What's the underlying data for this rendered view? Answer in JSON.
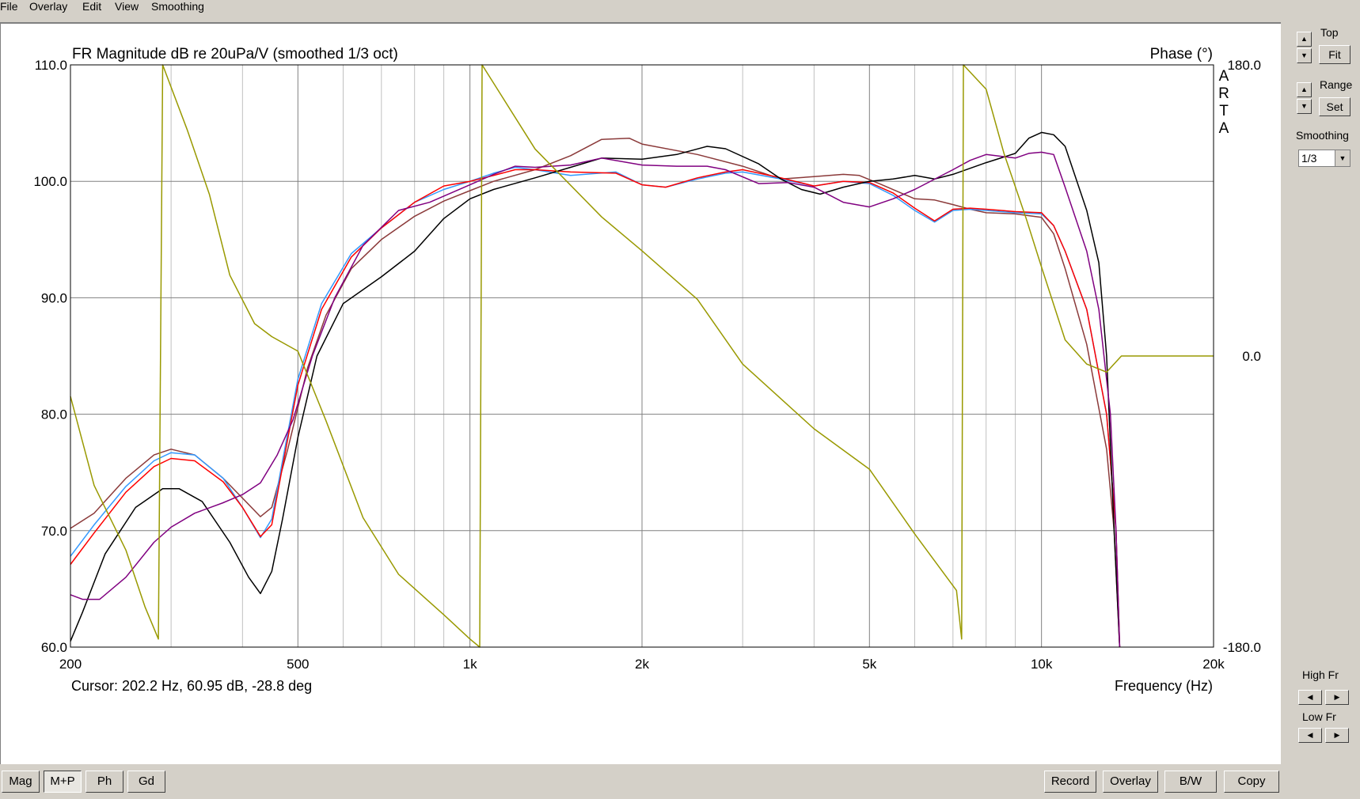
{
  "menu": {
    "items": [
      "File",
      "Overlay",
      "Edit",
      "View",
      "Smoothing"
    ]
  },
  "side": {
    "top_label": "Top",
    "fit_label": "Fit",
    "range_label": "Range",
    "set_label": "Set",
    "smoothing_label": "Smoothing",
    "smoothing_value": "1/3",
    "high_fr_label": "High Fr",
    "low_fr_label": "Low Fr",
    "arrow_up": "▲",
    "arrow_down": "▼",
    "arrow_left": "◀",
    "arrow_right": "▶"
  },
  "bottom": {
    "left_buttons": [
      "Mag",
      "M+P",
      "Ph",
      "Gd"
    ],
    "active_button": "M+P",
    "right_buttons": [
      "Record",
      "Overlay",
      "B/W",
      "Copy"
    ]
  },
  "chart_data": {
    "type": "line",
    "title": "FR Magnitude dB re 20uPa/V (smoothed 1/3 oct)",
    "right_title": "Phase (°)",
    "xlabel": "Frequency (Hz)",
    "vertical_tag": "ARTA",
    "cursor_text": "Cursor: 202.2 Hz, 60.95 dB, -28.8 deg",
    "x_scale": "log",
    "xlim": [
      200,
      20000
    ],
    "ylim": [
      60,
      110
    ],
    "y2lim": [
      -180,
      180
    ],
    "x_ticks": [
      {
        "v": 200,
        "label": "200"
      },
      {
        "v": 500,
        "label": "500"
      },
      {
        "v": 1000,
        "label": "1k"
      },
      {
        "v": 2000,
        "label": "2k"
      },
      {
        "v": 5000,
        "label": "5k"
      },
      {
        "v": 10000,
        "label": "10k"
      },
      {
        "v": 20000,
        "label": "20k"
      }
    ],
    "y_ticks": [
      "60.0",
      "70.0",
      "80.0",
      "90.0",
      "100.0",
      "110.0"
    ],
    "y2_ticks": [
      {
        "v": -180,
        "label": "-180.0"
      },
      {
        "v": 0,
        "label": "0.0"
      },
      {
        "v": 180,
        "label": "180.0"
      }
    ],
    "grid": true,
    "series": [
      {
        "color": "#8b3a3a",
        "axis": "left",
        "points": [
          [
            200,
            70.2
          ],
          [
            220,
            71.5
          ],
          [
            250,
            74.5
          ],
          [
            280,
            76.5
          ],
          [
            300,
            77
          ],
          [
            330,
            76.5
          ],
          [
            370,
            74.5
          ],
          [
            400,
            72.8
          ],
          [
            430,
            71.2
          ],
          [
            450,
            72
          ],
          [
            480,
            77
          ],
          [
            520,
            84
          ],
          [
            560,
            88.5
          ],
          [
            620,
            92.5
          ],
          [
            700,
            95
          ],
          [
            800,
            97
          ],
          [
            900,
            98.3
          ],
          [
            1000,
            99.2
          ],
          [
            1100,
            100
          ],
          [
            1300,
            101
          ],
          [
            1500,
            102.2
          ],
          [
            1700,
            103.6
          ],
          [
            1900,
            103.7
          ],
          [
            2000,
            103.2
          ],
          [
            2500,
            102.3
          ],
          [
            3000,
            101.3
          ],
          [
            3500,
            100.2
          ],
          [
            4000,
            100.4
          ],
          [
            4500,
            100.6
          ],
          [
            4800,
            100.5
          ],
          [
            5200,
            99.8
          ],
          [
            6000,
            98.5
          ],
          [
            6500,
            98.4
          ],
          [
            7000,
            98
          ],
          [
            7500,
            97.6
          ],
          [
            8000,
            97.3
          ],
          [
            9000,
            97.2
          ],
          [
            10000,
            96.9
          ],
          [
            10500,
            95.5
          ],
          [
            11000,
            92.5
          ],
          [
            12000,
            86
          ],
          [
            13000,
            77
          ],
          [
            13400,
            70
          ],
          [
            13700,
            60
          ]
        ]
      },
      {
        "color": "#3399ff",
        "axis": "left",
        "points": [
          [
            200,
            67.8
          ],
          [
            220,
            70.5
          ],
          [
            250,
            73.8
          ],
          [
            280,
            76
          ],
          [
            300,
            76.7
          ],
          [
            330,
            76.5
          ],
          [
            370,
            74.5
          ],
          [
            400,
            72
          ],
          [
            430,
            69.4
          ],
          [
            450,
            71
          ],
          [
            470,
            76
          ],
          [
            500,
            83
          ],
          [
            550,
            89.5
          ],
          [
            620,
            93.8
          ],
          [
            700,
            96
          ],
          [
            800,
            98.2
          ],
          [
            900,
            99.3
          ],
          [
            1000,
            100
          ],
          [
            1100,
            100.7
          ],
          [
            1200,
            101.2
          ],
          [
            1300,
            101
          ],
          [
            1500,
            100.5
          ],
          [
            1800,
            100.8
          ],
          [
            2000,
            99.7
          ],
          [
            2200,
            99.5
          ],
          [
            2500,
            100.2
          ],
          [
            2800,
            100.7
          ],
          [
            3000,
            100.8
          ],
          [
            3500,
            100.2
          ],
          [
            4000,
            99.6
          ],
          [
            4500,
            100
          ],
          [
            5000,
            99.8
          ],
          [
            5500,
            98.8
          ],
          [
            6000,
            97.5
          ],
          [
            6500,
            96.5
          ],
          [
            7000,
            97.5
          ],
          [
            7500,
            97.6
          ],
          [
            8000,
            97.5
          ],
          [
            9000,
            97.3
          ],
          [
            10000,
            97.2
          ],
          [
            10500,
            96.2
          ],
          [
            11000,
            94
          ],
          [
            12000,
            89
          ],
          [
            13000,
            80
          ],
          [
            13500,
            70
          ],
          [
            13700,
            60
          ]
        ]
      },
      {
        "color": "#ff0000",
        "axis": "left",
        "points": [
          [
            200,
            67.1
          ],
          [
            220,
            69.8
          ],
          [
            250,
            73.3
          ],
          [
            280,
            75.5
          ],
          [
            300,
            76.2
          ],
          [
            330,
            76
          ],
          [
            370,
            74.2
          ],
          [
            400,
            72
          ],
          [
            430,
            69.5
          ],
          [
            450,
            70.5
          ],
          [
            470,
            75.5
          ],
          [
            500,
            82.5
          ],
          [
            550,
            89
          ],
          [
            620,
            93.5
          ],
          [
            700,
            96
          ],
          [
            800,
            98.2
          ],
          [
            900,
            99.6
          ],
          [
            1000,
            100
          ],
          [
            1100,
            100.5
          ],
          [
            1200,
            101
          ],
          [
            1300,
            101
          ],
          [
            1500,
            100.8
          ],
          [
            1800,
            100.7
          ],
          [
            2000,
            99.7
          ],
          [
            2200,
            99.5
          ],
          [
            2500,
            100.3
          ],
          [
            2800,
            100.8
          ],
          [
            3000,
            101
          ],
          [
            3500,
            100.3
          ],
          [
            4000,
            99.6
          ],
          [
            4500,
            100
          ],
          [
            5000,
            99.9
          ],
          [
            5500,
            99
          ],
          [
            6000,
            97.7
          ],
          [
            6500,
            96.6
          ],
          [
            7000,
            97.6
          ],
          [
            7500,
            97.7
          ],
          [
            8000,
            97.6
          ],
          [
            9000,
            97.4
          ],
          [
            10000,
            97.3
          ],
          [
            10500,
            96.2
          ],
          [
            11000,
            94
          ],
          [
            12000,
            89
          ],
          [
            13000,
            80
          ],
          [
            13500,
            70
          ],
          [
            13700,
            60
          ]
        ]
      },
      {
        "color": "#000000",
        "axis": "left",
        "points": [
          [
            200,
            60.5
          ],
          [
            210,
            63
          ],
          [
            230,
            68
          ],
          [
            260,
            72
          ],
          [
            290,
            73.6
          ],
          [
            310,
            73.6
          ],
          [
            340,
            72.5
          ],
          [
            380,
            69
          ],
          [
            410,
            66
          ],
          [
            430,
            64.6
          ],
          [
            450,
            66.5
          ],
          [
            470,
            71
          ],
          [
            500,
            78
          ],
          [
            540,
            85
          ],
          [
            600,
            89.5
          ],
          [
            700,
            91.8
          ],
          [
            800,
            94
          ],
          [
            900,
            96.8
          ],
          [
            1000,
            98.5
          ],
          [
            1100,
            99.3
          ],
          [
            1300,
            100.3
          ],
          [
            1500,
            101.2
          ],
          [
            1700,
            102
          ],
          [
            2000,
            101.9
          ],
          [
            2300,
            102.3
          ],
          [
            2600,
            103
          ],
          [
            2800,
            102.8
          ],
          [
            3200,
            101.5
          ],
          [
            3500,
            100.2
          ],
          [
            3800,
            99.3
          ],
          [
            4100,
            98.9
          ],
          [
            4500,
            99.5
          ],
          [
            5000,
            100
          ],
          [
            5500,
            100.2
          ],
          [
            6000,
            100.5
          ],
          [
            6500,
            100.2
          ],
          [
            7000,
            100.6
          ],
          [
            8000,
            101.6
          ],
          [
            9000,
            102.4
          ],
          [
            9500,
            103.7
          ],
          [
            10000,
            104.2
          ],
          [
            10500,
            104
          ],
          [
            11000,
            103
          ],
          [
            12000,
            97.5
          ],
          [
            12600,
            93
          ],
          [
            13000,
            85
          ],
          [
            13400,
            70
          ],
          [
            13700,
            60
          ]
        ]
      },
      {
        "color": "#800080",
        "axis": "left",
        "points": [
          [
            200,
            64.5
          ],
          [
            210,
            64.1
          ],
          [
            225,
            64.1
          ],
          [
            250,
            66
          ],
          [
            280,
            69
          ],
          [
            300,
            70.3
          ],
          [
            330,
            71.5
          ],
          [
            370,
            72.4
          ],
          [
            400,
            73.1
          ],
          [
            430,
            74.1
          ],
          [
            460,
            76.5
          ],
          [
            490,
            79.5
          ],
          [
            530,
            85
          ],
          [
            580,
            90
          ],
          [
            650,
            94.5
          ],
          [
            750,
            97.5
          ],
          [
            850,
            98.2
          ],
          [
            1000,
            99.7
          ],
          [
            1100,
            100.6
          ],
          [
            1200,
            101.3
          ],
          [
            1300,
            101.2
          ],
          [
            1500,
            101.4
          ],
          [
            1700,
            102
          ],
          [
            2000,
            101.4
          ],
          [
            2300,
            101.3
          ],
          [
            2600,
            101.3
          ],
          [
            2800,
            101
          ],
          [
            3200,
            99.8
          ],
          [
            3600,
            99.9
          ],
          [
            4000,
            99.5
          ],
          [
            4500,
            98.2
          ],
          [
            5000,
            97.8
          ],
          [
            5500,
            98.5
          ],
          [
            6000,
            99.3
          ],
          [
            7000,
            101
          ],
          [
            7500,
            101.8
          ],
          [
            8000,
            102.3
          ],
          [
            9000,
            102
          ],
          [
            9500,
            102.4
          ],
          [
            10000,
            102.5
          ],
          [
            10500,
            102.3
          ],
          [
            11000,
            99.5
          ],
          [
            12000,
            94
          ],
          [
            12600,
            89
          ],
          [
            13200,
            80
          ],
          [
            13500,
            70
          ],
          [
            13700,
            60
          ]
        ]
      },
      {
        "color": "#999900",
        "axis": "right",
        "points": [
          [
            200,
            -25
          ],
          [
            220,
            -80
          ],
          [
            250,
            -120
          ],
          [
            270,
            -155
          ],
          [
            285,
            -175
          ],
          [
            290,
            180
          ],
          [
            320,
            140
          ],
          [
            350,
            100
          ],
          [
            380,
            50
          ],
          [
            420,
            20
          ],
          [
            450,
            12
          ],
          [
            500,
            3
          ],
          [
            560,
            -40
          ],
          [
            650,
            -100
          ],
          [
            750,
            -135
          ],
          [
            900,
            -160
          ],
          [
            1000,
            -175
          ],
          [
            1040,
            -180
          ],
          [
            1050,
            180
          ],
          [
            1300,
            128
          ],
          [
            1700,
            86
          ],
          [
            2000,
            65
          ],
          [
            2500,
            35
          ],
          [
            3000,
            -5
          ],
          [
            4000,
            -45
          ],
          [
            5000,
            -70
          ],
          [
            6000,
            -110
          ],
          [
            7100,
            -145
          ],
          [
            7250,
            -175
          ],
          [
            7300,
            180
          ],
          [
            8000,
            165
          ],
          [
            8600,
            125
          ],
          [
            9400,
            85
          ],
          [
            10000,
            55
          ],
          [
            11000,
            10
          ],
          [
            12000,
            -5
          ],
          [
            13000,
            -10
          ],
          [
            13800,
            0
          ],
          [
            20000,
            0
          ]
        ]
      }
    ]
  }
}
